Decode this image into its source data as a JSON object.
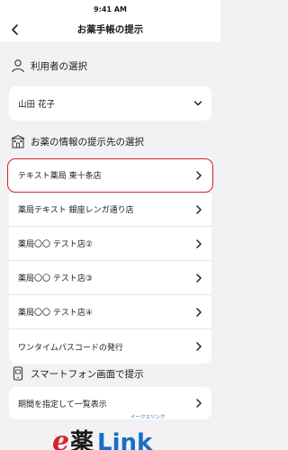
{
  "status": {
    "time": "9:41 AM"
  },
  "header": {
    "title": "お薬手帳の提示"
  },
  "user_section": {
    "title": "利用者の選択",
    "selected_user": "山田 花子"
  },
  "pharmacy_section": {
    "title": "お薬の情報の提示先の選択",
    "items": [
      {
        "label": "テキスト薬局 東十条店"
      },
      {
        "label": "薬局テキスト 銀座レンガ通り店"
      },
      {
        "label": "薬局〇〇 テスト店②"
      },
      {
        "label": "薬局〇〇 テスト店③"
      },
      {
        "label": "薬局〇〇 テスト店④"
      },
      {
        "label": "ワンタイムパスコードの発行"
      }
    ]
  },
  "phone_section": {
    "title": "スマートフォン画面で提示",
    "item_label": "期間を指定して一覧表示"
  },
  "brand": {
    "small_text": "イークスリンク",
    "accent": "#d8232a",
    "blue": "#1a6fc4"
  }
}
